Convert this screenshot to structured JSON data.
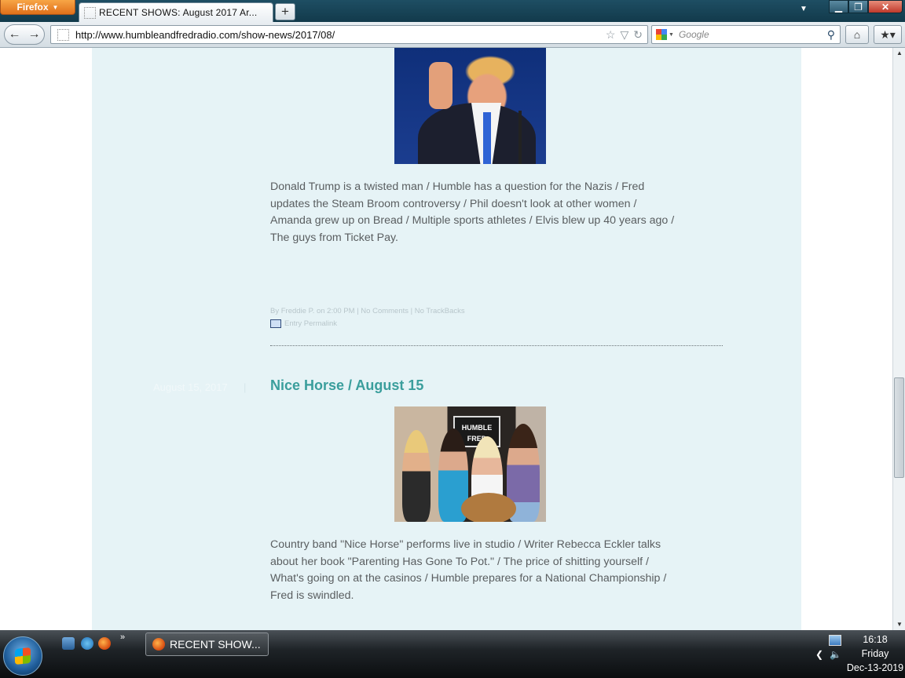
{
  "browser": {
    "menu_button": "Firefox",
    "tab_title": "RECENT  SHOWS:  August  2017 Ar...",
    "new_tab": "+",
    "url": "http://www.humbleandfredradio.com/show-news/2017/08/",
    "search_placeholder": "Google"
  },
  "posts": [
    {
      "description": "Donald Trump is a twisted man / Humble has a question for the Nazis / Fred updates the Steam Broom controversy / Phil doesn't look at other women / Amanda grew up on Bread / Multiple sports athletes / Elvis blew up 40 years ago / The guys from Ticket Pay.",
      "meta": "By Freddie P. on 2:00 PM | No Comments | No TrackBacks",
      "permalink": "Entry Permalink"
    },
    {
      "date": "August 15, 2017",
      "date_separator": "|",
      "title": "Nice Horse / August 15",
      "image_sign": "HUMBLE FRED",
      "description": "Country band \"Nice Horse\" performs live in studio / Writer Rebecca Eckler talks about her book \"Parenting Has Gone To Pot.\" / The price of shitting yourself / What's going on at the casinos / Humble prepares for a National Championship / Fred is swindled."
    }
  ],
  "taskbar": {
    "more": "»",
    "task_label": "RECENT  SHOW...",
    "time": "16:18",
    "day": "Friday",
    "date": "Dec-13-2019"
  },
  "colors": {
    "content_bg": "#e6f3f6",
    "post_title": "#3a9e9c",
    "body_text": "#5a5e60"
  }
}
